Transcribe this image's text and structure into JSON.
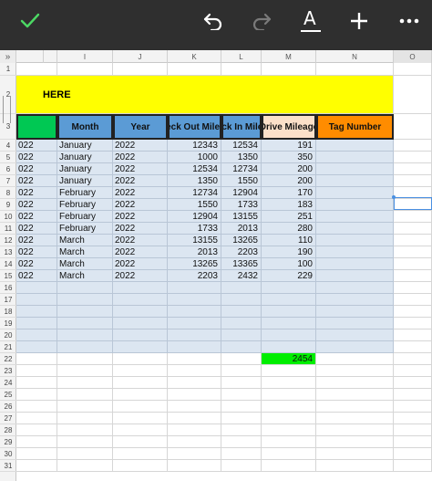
{
  "toolbar": {
    "confirm_icon": "checkmark-icon",
    "undo_icon": "undo-icon",
    "redo_icon": "redo-icon",
    "text_format_label": "A",
    "add_label": "+",
    "more_label": "•••"
  },
  "column_headers": [
    "I",
    "J",
    "K",
    "L",
    "M",
    "N",
    "O"
  ],
  "collapse_arrow": "»",
  "row_numbers": [
    "1",
    "2",
    "3",
    "4",
    "5",
    "6",
    "7",
    "8",
    "9",
    "10",
    "11",
    "12",
    "13",
    "14",
    "15",
    "16",
    "17",
    "18",
    "19",
    "20",
    "21",
    "22",
    "23",
    "24",
    "25",
    "26",
    "27",
    "28",
    "29",
    "30",
    "31"
  ],
  "title_text": "HERE",
  "table": {
    "headers": {
      "month": "Month",
      "year": "Year",
      "check_out": "Check Out Mileage",
      "check_in": "Check In Mileage",
      "drive": "Drive Mileage",
      "tag": "Tag Number"
    },
    "rows": [
      {
        "h": "022",
        "month": "January",
        "year": "2022",
        "out": "12343",
        "in": "12534",
        "drive": "191"
      },
      {
        "h": "022",
        "month": "January",
        "year": "2022",
        "out": "1000",
        "in": "1350",
        "drive": "350"
      },
      {
        "h": "022",
        "month": "January",
        "year": "2022",
        "out": "12534",
        "in": "12734",
        "drive": "200"
      },
      {
        "h": "022",
        "month": "January",
        "year": "2022",
        "out": "1350",
        "in": "1550",
        "drive": "200"
      },
      {
        "h": "022",
        "month": "February",
        "year": "2022",
        "out": "12734",
        "in": "12904",
        "drive": "170"
      },
      {
        "h": "022",
        "month": "February",
        "year": "2022",
        "out": "1550",
        "in": "1733",
        "drive": "183"
      },
      {
        "h": "022",
        "month": "February",
        "year": "2022",
        "out": "12904",
        "in": "13155",
        "drive": "251"
      },
      {
        "h": "022",
        "month": "February",
        "year": "2022",
        "out": "1733",
        "in": "2013",
        "drive": "280"
      },
      {
        "h": "022",
        "month": "March",
        "year": "2022",
        "out": "13155",
        "in": "13265",
        "drive": "110"
      },
      {
        "h": "022",
        "month": "March",
        "year": "2022",
        "out": "2013",
        "in": "2203",
        "drive": "190"
      },
      {
        "h": "022",
        "month": "March",
        "year": "2022",
        "out": "13265",
        "in": "13365",
        "drive": "100"
      },
      {
        "h": "022",
        "month": "March",
        "year": "2022",
        "out": "2203",
        "in": "2432",
        "drive": "229"
      }
    ],
    "total_drive": "2454"
  },
  "colors": {
    "toolbar_bg": "#2f2f2f",
    "checkmark": "#4cd964",
    "title_yellow": "#ffff00",
    "header_green": "#00c853",
    "header_blue": "#5b9bd5",
    "header_peach": "#fbe0c9",
    "header_orange": "#ff8c00",
    "table_fill": "#dce6f1",
    "total_green": "#00ee00",
    "selection_blue": "#4a90e2"
  }
}
